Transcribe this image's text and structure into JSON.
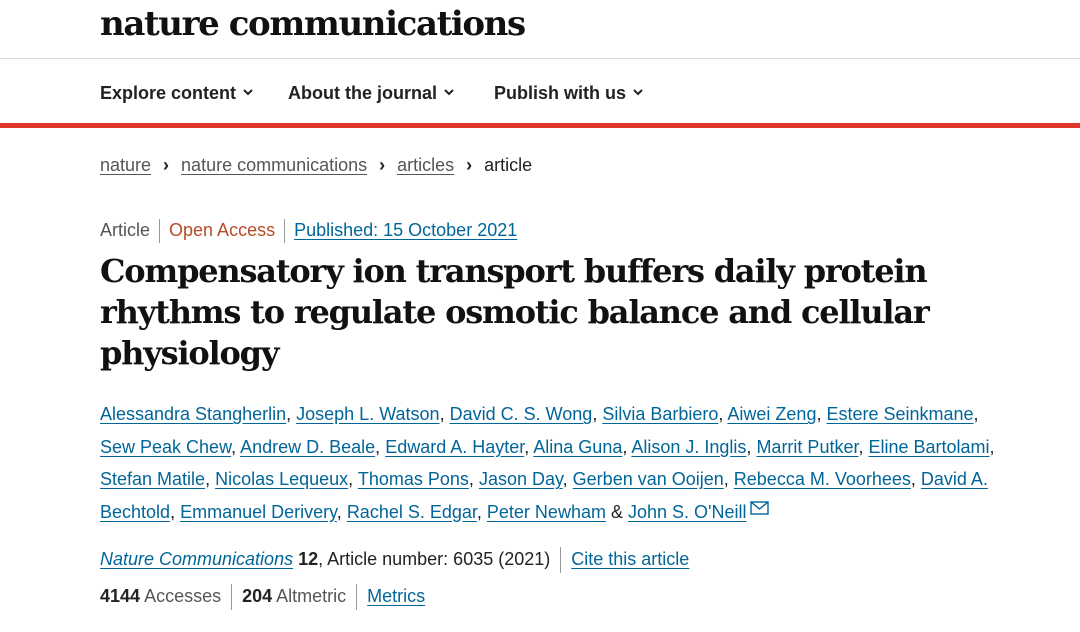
{
  "header": {
    "logo": "nature communications"
  },
  "nav": {
    "items": [
      {
        "label": "Explore content"
      },
      {
        "label": "About the journal"
      },
      {
        "label": "Publish with us"
      }
    ]
  },
  "colors": {
    "accent_bar": "#e0372b",
    "link": "#006699",
    "open_access": "#b84b26"
  },
  "breadcrumb": {
    "items": [
      "nature",
      "nature communications",
      "articles"
    ],
    "current": "article"
  },
  "article": {
    "type": "Article",
    "access": "Open Access",
    "published": "Published: 15 October 2021",
    "title": "Compensatory ion transport buffers daily protein rhythms to regulate osmotic balance and cellular physiology",
    "authors": [
      "Alessandra Stangherlin",
      "Joseph L. Watson",
      "David C. S. Wong",
      "Silvia Barbiero",
      "Aiwei Zeng",
      "Estere Seinkmane",
      "Sew Peak Chew",
      "Andrew D. Beale",
      "Edward A. Hayter",
      "Alina Guna",
      "Alison J. Inglis",
      "Marrit Putker",
      "Eline Bartolami",
      "Stefan Matile",
      "Nicolas Lequeux",
      "Thomas Pons",
      "Jason Day",
      "Gerben van Ooijen",
      "Rebecca M. Voorhees",
      "David A. Bechtold",
      "Emmanuel Derivery",
      "Rachel S. Edgar",
      "Peter Newham",
      "John S. O'Neill"
    ],
    "author_joiner": "&",
    "journal": {
      "name": "Nature Communications",
      "volume": "12",
      "article_number": ", Article number: 6035 (2021)",
      "cite_label": "Cite this article"
    },
    "stats": {
      "accesses_value": "4144",
      "accesses_label": "Accesses",
      "altmetric_value": "204",
      "altmetric_label": "Altmetric",
      "metrics_link": "Metrics"
    }
  }
}
